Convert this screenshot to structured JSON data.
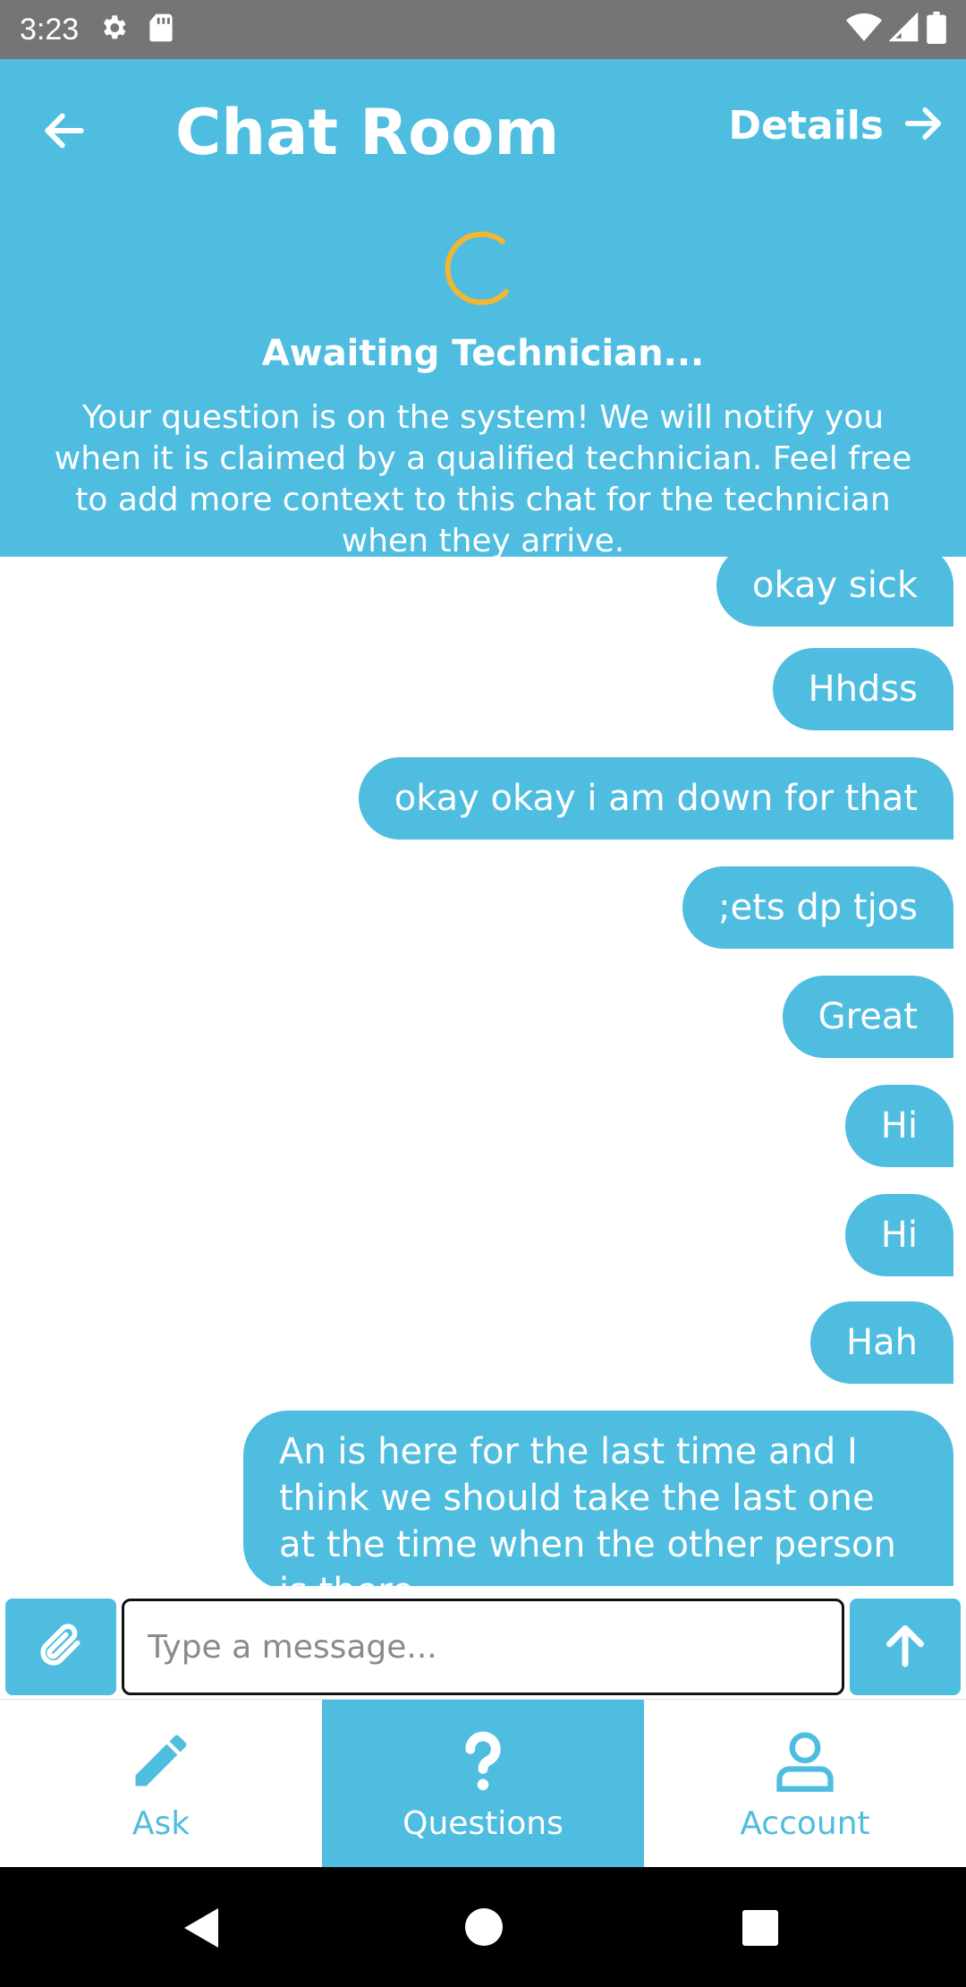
{
  "status_bar": {
    "time": "3:23",
    "icons": [
      "gear-icon",
      "sd-card-icon",
      "wifi-icon",
      "signal-icon",
      "battery-icon"
    ]
  },
  "header": {
    "title": "Chat Room",
    "details_label": "Details",
    "awaiting_title": "Awaiting Technician...",
    "awaiting_description": "Your question is on the system! We will notify you when it is claimed by a qualified technician. Feel free to add more context to this chat for the technician when they arrive.",
    "background_color": "#4fbde0",
    "spinner_color": "#f2b632"
  },
  "messages": [
    {
      "text": "okay sick"
    },
    {
      "text": "Hhdss"
    },
    {
      "text": "okay okay i am down for that"
    },
    {
      "text": ";ets dp tjos"
    },
    {
      "text": "Great"
    },
    {
      "text": "Hi"
    },
    {
      "text": "Hi"
    },
    {
      "text": "Hah"
    },
    {
      "text": "An is here for the last time and I think we should take the last one at the time when the other person is there"
    }
  ],
  "composer": {
    "placeholder": "Type a message...",
    "value": "",
    "attach_icon": "paperclip-icon",
    "send_icon": "arrow-up-icon"
  },
  "tabs": [
    {
      "label": "Ask",
      "icon": "pencil-icon",
      "active": false
    },
    {
      "label": "Questions",
      "icon": "question-mark-icon",
      "active": true
    },
    {
      "label": "Account",
      "icon": "person-icon",
      "active": false
    }
  ]
}
